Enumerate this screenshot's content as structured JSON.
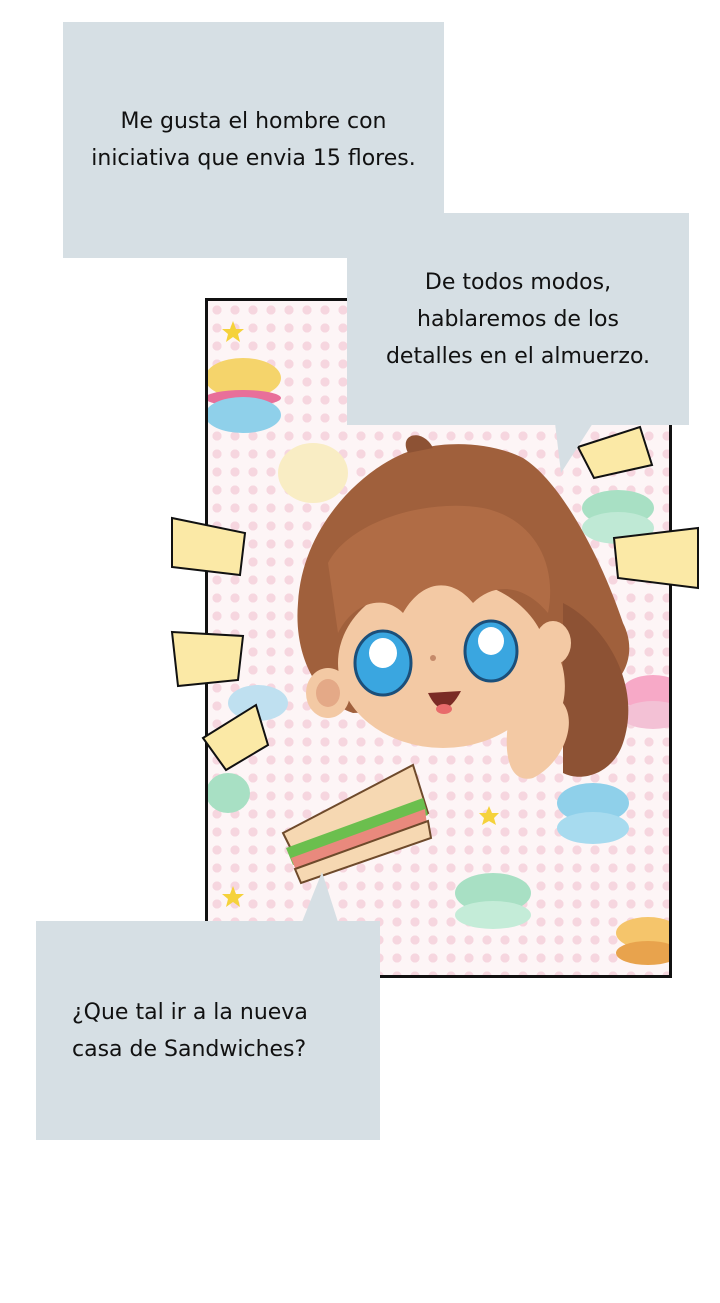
{
  "bubbles": {
    "top": "Me gusta el hombre con iniciativa que envia 15 flores.",
    "middle": "De todos modos, hablaremos de los detalles en el almuerzo.",
    "bottom": "¿Que tal ir a la nueva casa de Sandwiches?"
  },
  "illustration": {
    "subject": "chibi-girl-with-sandwich",
    "background": "pink-dotted-macarons"
  },
  "colors": {
    "bubble": "#d6dfe4",
    "panel_border": "#111111",
    "hair": "#a0603c",
    "eyes": "#3aa6e0",
    "burst": "#fbe9a6"
  }
}
